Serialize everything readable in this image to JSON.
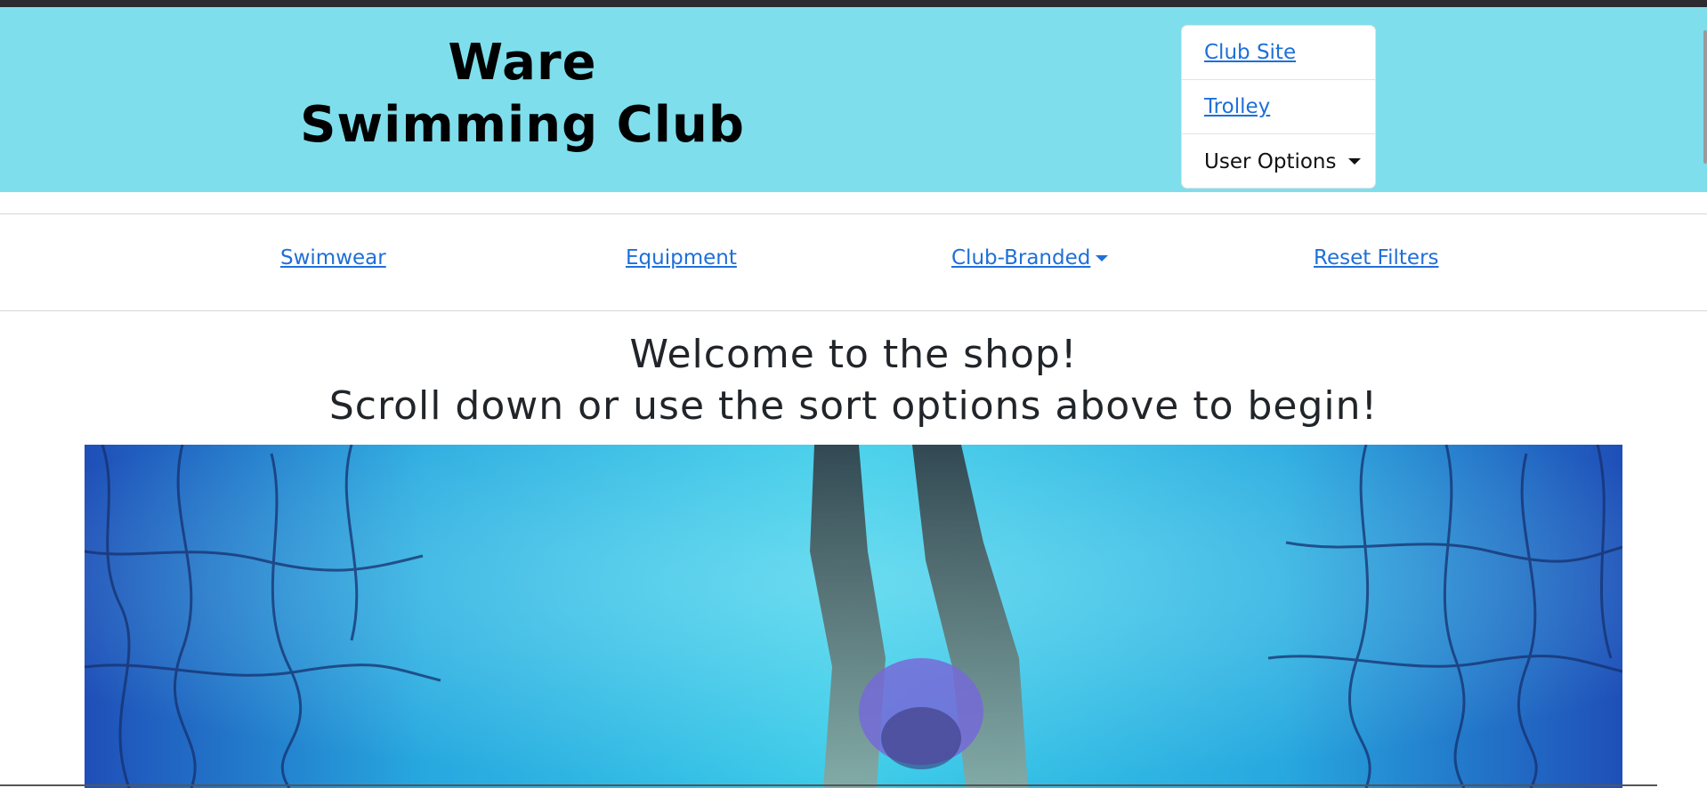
{
  "header": {
    "title_line1": "Ware",
    "title_line2": "Swimming Club",
    "background_color": "#7fdeec"
  },
  "user_menu": {
    "club_site": "Club Site",
    "trolley": "Trolley",
    "user_options": "User Options"
  },
  "nav": {
    "items": [
      {
        "label": "Swimwear"
      },
      {
        "label": "Equipment"
      },
      {
        "label": "Club-Branded"
      },
      {
        "label": "Reset Filters"
      }
    ],
    "link_color": "#1e6fd9"
  },
  "welcome": {
    "line1": "Welcome to the shop!",
    "line2": "Scroll down or use the sort options above to begin!"
  },
  "hero": {
    "icon": "swimmer-underwater-photo"
  }
}
